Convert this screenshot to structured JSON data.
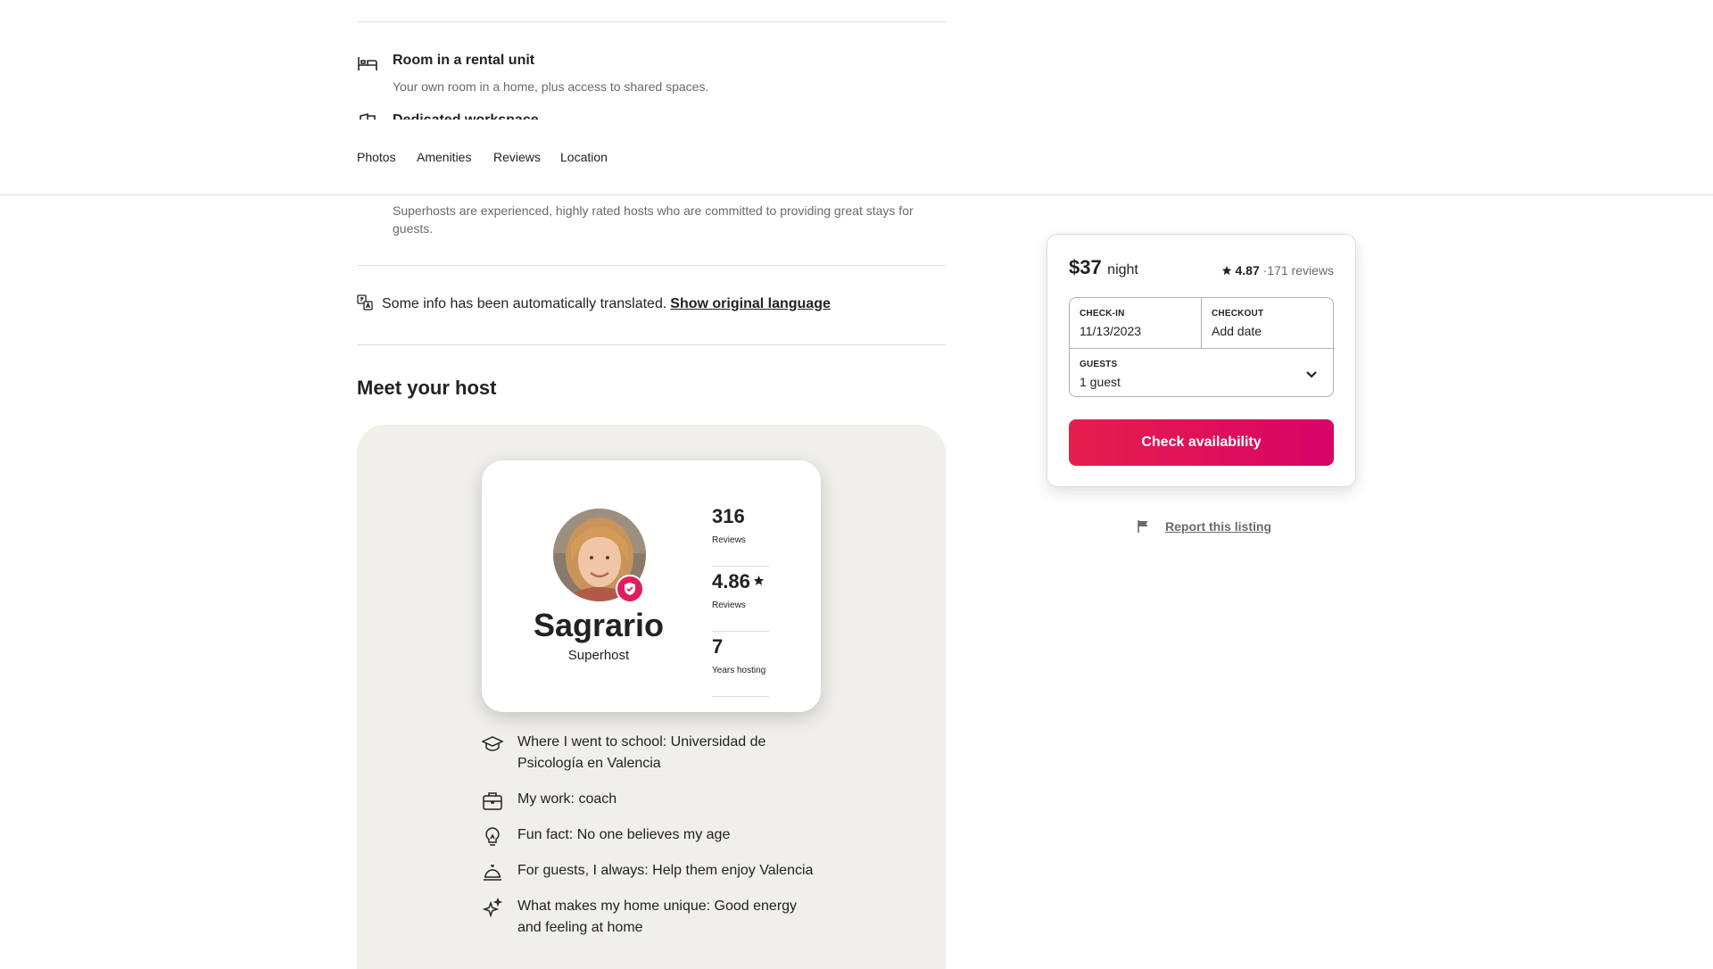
{
  "highlights": {
    "room": {
      "icon": "bed-icon",
      "title": "Room in a rental unit",
      "subtitle": "Your own room in a home, plus access to shared spaces."
    },
    "partial": {
      "icon": "door-icon",
      "title": "Dedicated workspace"
    },
    "superhost_desc": "Superhosts are experienced, highly rated hosts who are committed to providing great stays for guests."
  },
  "translate": {
    "text": "Some info has been automatically translated.",
    "link": "Show original language"
  },
  "subnav": {
    "tabs": [
      "Photos",
      "Amenities",
      "Reviews",
      "Location"
    ]
  },
  "host": {
    "section_title": "Meet your host",
    "name": "Sagrario",
    "role": "Superhost",
    "stats": [
      {
        "value": "316",
        "label": "Reviews"
      },
      {
        "value": "4.86",
        "label": "Reviews"
      },
      {
        "value": "7",
        "label": "Years hosting"
      }
    ],
    "facts": [
      {
        "icon": "graduation-cap-icon",
        "text": "Where I went to school: Universidad de Psicología en Valencia"
      },
      {
        "icon": "briefcase-icon",
        "text": "My work: coach"
      },
      {
        "icon": "lightbulb-icon",
        "text": "Fun fact: No one believes my age"
      },
      {
        "icon": "service-bell-icon",
        "text": "For guests, I always: Help them enjoy Valencia"
      },
      {
        "icon": "sparkles-icon",
        "text": "What makes my home unique: Good energy and feeling at home"
      }
    ]
  },
  "booking": {
    "price": "$37",
    "price_unit": "night",
    "rating": "4.87",
    "reviews": "171 reviews",
    "checkin_label": "CHECK-IN",
    "checkin_value": "11/13/2023",
    "checkout_label": "CHECKOUT",
    "checkout_value": "Add date",
    "guests_label": "GUESTS",
    "guests_value": "1 guest",
    "cta": "Check availability",
    "accent": "#e31c5f"
  },
  "report": {
    "text": "Report this listing"
  }
}
